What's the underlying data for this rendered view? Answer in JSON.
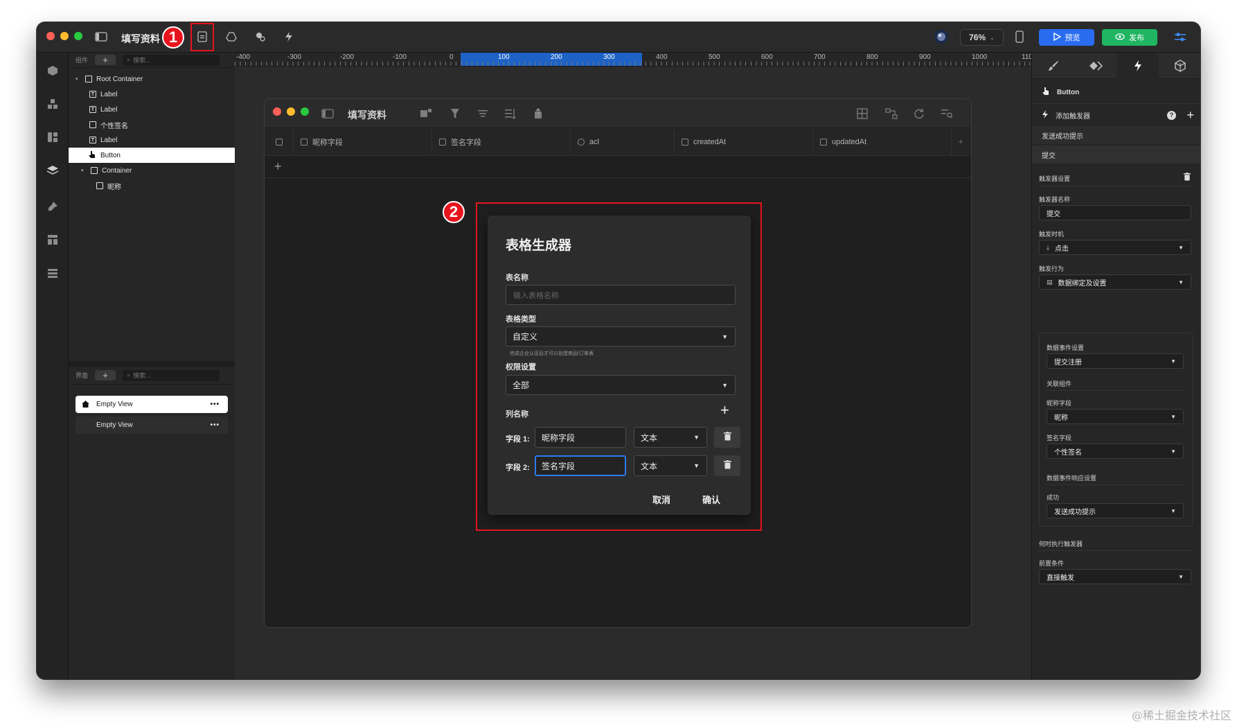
{
  "app": {
    "title": "填写资料",
    "zoom": "76%",
    "preview_label": "预览",
    "publish_label": "发布"
  },
  "annotations": {
    "marker_1": "1",
    "marker_2": "2"
  },
  "tree_panel": {
    "header": "组件",
    "search_placeholder": "搜索...",
    "items": [
      {
        "label": "Root Container",
        "icon": "container-icon"
      },
      {
        "label": "Label",
        "icon": "text-icon"
      },
      {
        "label": "Label",
        "icon": "text-icon"
      },
      {
        "label": "个性签名",
        "icon": "input-icon"
      },
      {
        "label": "Label",
        "icon": "text-icon"
      },
      {
        "label": "Button",
        "icon": "hand-pointer-icon"
      },
      {
        "label": "Container",
        "icon": "container-icon"
      },
      {
        "label": "昵称",
        "icon": "input-icon"
      }
    ]
  },
  "views_panel": {
    "header": "界面",
    "search_placeholder": "搜索...",
    "items": [
      {
        "label": "Empty View",
        "more": "•••"
      },
      {
        "label": "Empty View",
        "more": "•••"
      }
    ]
  },
  "ruler": {
    "labels": [
      "-400",
      "-300",
      "-200",
      "-100",
      "0",
      "100",
      "200",
      "300",
      "400",
      "500",
      "600",
      "700",
      "800",
      "900",
      "1000",
      "110"
    ]
  },
  "inner_window": {
    "title": "填写资料",
    "columns": [
      "昵称字段",
      "签名字段",
      "acl",
      "createdAt",
      "updatedAt"
    ],
    "add_row": "+"
  },
  "dialog": {
    "title": "表格生成器",
    "table_name_label": "表名称",
    "table_name_placeholder": "输入表格名称",
    "table_type_label": "表格类型",
    "table_type_value": "自定义",
    "note": "完成企业认证后才可以创建商品/订单表",
    "permission_label": "权限设置",
    "permission_value": "全部",
    "columns_label": "列名称",
    "fields": [
      {
        "label": "字段 1:",
        "name": "昵称字段",
        "type": "文本"
      },
      {
        "label": "字段 2:",
        "name": "签名字段",
        "type": "文本"
      }
    ],
    "cancel": "取消",
    "confirm": "确认"
  },
  "inspector": {
    "selected": "Button",
    "add_trigger": "添加触发器",
    "trigger_items": [
      "发送成功提示",
      "提交"
    ],
    "trigger_settings": "触发器设置",
    "trigger_name_label": "触发器名称",
    "trigger_name_value": "提交",
    "trigger_timing_label": "触发时机",
    "trigger_timing_value": "点击",
    "trigger_action_label": "触发行为",
    "trigger_action_value": "数据绑定及设置",
    "data_event_label": "数据事件设置",
    "data_event_value": "提交注册",
    "related_label": "关联组件",
    "nickname_field_label": "昵称字段",
    "nickname_field_value": "昵称",
    "signature_field_label": "签名字段",
    "signature_field_value": "个性签名",
    "response_label": "数据事件响应设置",
    "success_label": "成功",
    "success_value": "发送成功提示",
    "when_execute_label": "何时执行触发器",
    "precondition_label": "前置条件",
    "precondition_value": "直接触发"
  },
  "watermark": "@稀土掘金技术社区"
}
